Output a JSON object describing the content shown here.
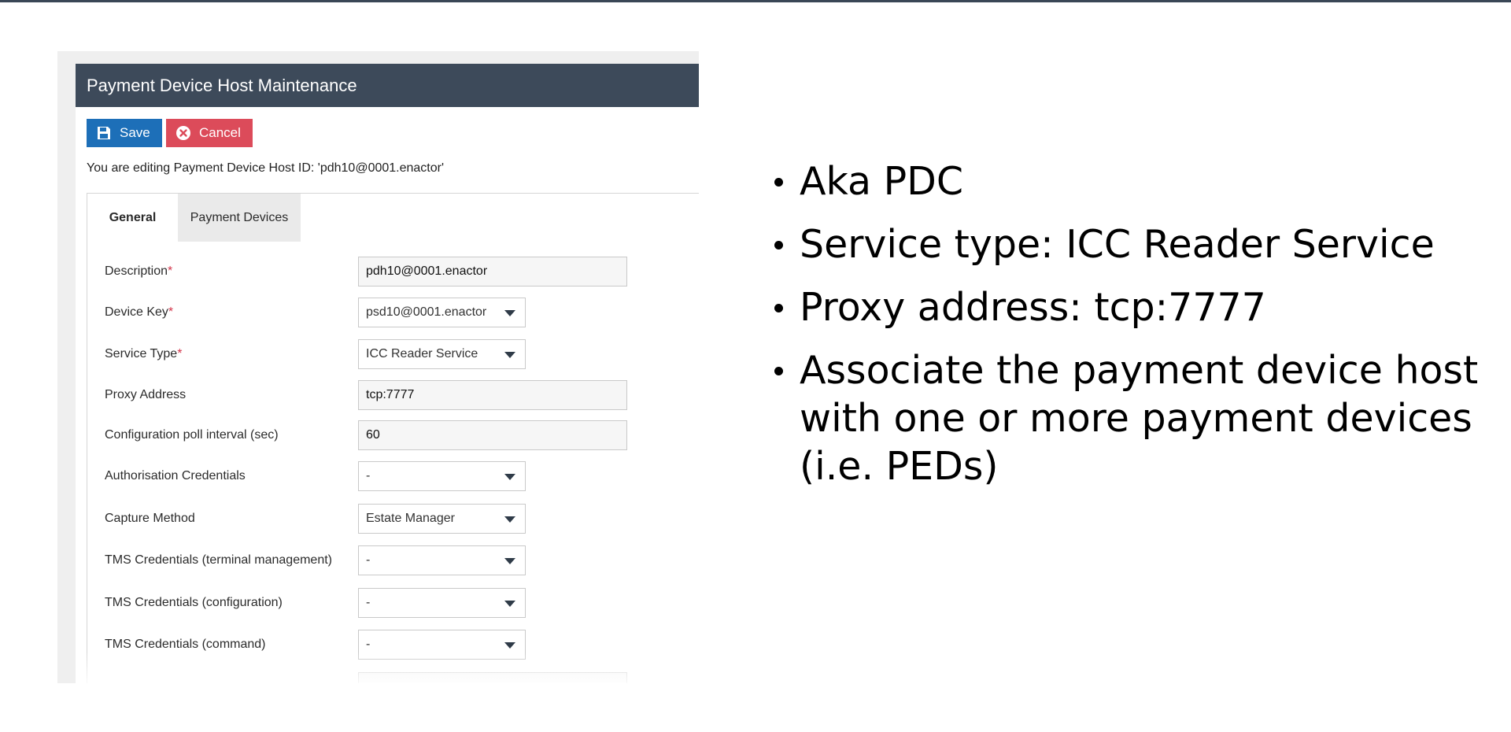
{
  "window": {
    "title": "Payment Device Host Maintenance"
  },
  "toolbar": {
    "save_label": "Save",
    "cancel_label": "Cancel"
  },
  "editing_message": "You are editing Payment Device Host ID: 'pdh10@0001.enactor'",
  "tabs": [
    {
      "label": "General",
      "active": true
    },
    {
      "label": "Payment Devices",
      "active": false
    }
  ],
  "form": {
    "description": {
      "label": "Description",
      "value": "pdh10@0001.enactor"
    },
    "device_key": {
      "label": "Device Key",
      "value": "psd10@0001.enactor"
    },
    "service_type": {
      "label": "Service Type",
      "value": "ICC Reader Service"
    },
    "proxy_address": {
      "label": "Proxy Address",
      "value": "tcp:7777"
    },
    "config_poll": {
      "label": "Configuration poll interval (sec)",
      "value": "60"
    },
    "auth_credentials": {
      "label": "Authorisation Credentials",
      "value": "-"
    },
    "capture_method": {
      "label": "Capture Method",
      "value": "Estate Manager"
    },
    "tms_terminal": {
      "label": "TMS Credentials (terminal management)",
      "value": "-"
    },
    "tms_config": {
      "label": "TMS Credentials (configuration)",
      "value": "-"
    },
    "tms_command": {
      "label": "TMS Credentials (command)",
      "value": "-"
    }
  },
  "required_marker": "*",
  "bullets": [
    "Aka PDC",
    "Service type: ICC Reader Service",
    "Proxy address: tcp:7777",
    "Associate the payment device host with one or more payment devices (i.e. PEDs)"
  ],
  "colors": {
    "title_bar": "#3d4a5a",
    "save_button": "#1d6fb8",
    "cancel_button": "#dc4b5a",
    "required": "#d3344a"
  },
  "icons": {
    "save": "floppy-disk-icon",
    "cancel": "circle-x-icon",
    "dropdown": "chevron-down-icon"
  }
}
